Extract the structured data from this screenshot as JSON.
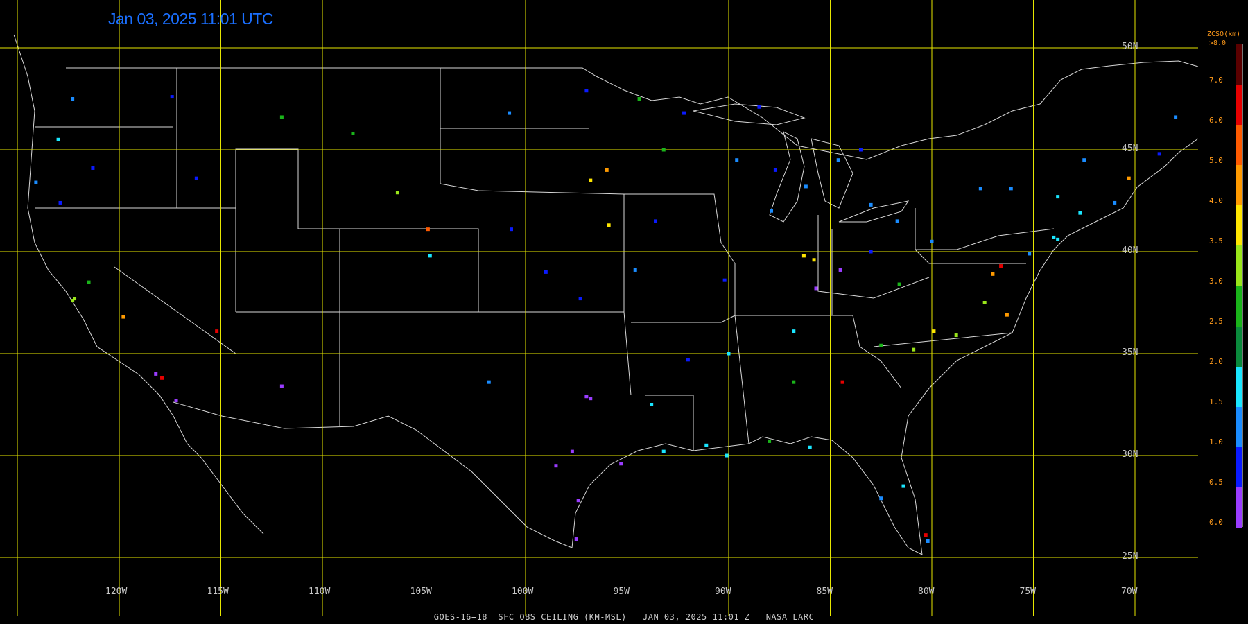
{
  "timestamp": "Jan 03, 2025 11:01 UTC",
  "footer": "GOES-16+18  SFC OBS CEILING (KM-MSL)   JAN 03, 2025 11:01 Z   NASA LARC",
  "colorbar": {
    "title": "ZCSO(km)",
    "max_label": ">8.0",
    "ticks": [
      "7.0",
      "6.0",
      "5.0",
      "4.0",
      "3.5",
      "3.0",
      "2.5",
      "2.0",
      "1.5",
      "1.0",
      "0.5",
      "0.0"
    ],
    "colors": [
      "#5a0000",
      "#e60000",
      "#ff5a00",
      "#ff9a00",
      "#ffe600",
      "#9ae61a",
      "#1ab41a",
      "#0a8a3c",
      "#1ae6ff",
      "#1a8cff",
      "#0a1aff",
      "#9a3cff"
    ]
  },
  "grid": {
    "lat_labels": [
      "50N",
      "45N",
      "40N",
      "35N",
      "30N",
      "25N"
    ],
    "lon_labels": [
      "120W",
      "115W",
      "110W",
      "105W",
      "100W",
      "95W",
      "90W",
      "85W",
      "80W",
      "75W",
      "70W"
    ],
    "lat_values": [
      50,
      45,
      40,
      35,
      30,
      25
    ],
    "lon_values": [
      -120,
      -115,
      -110,
      -105,
      -100,
      -95,
      -90,
      -85,
      -80,
      -75,
      -70
    ],
    "line_color": "#e6e600",
    "border_color": "#d8d8d8"
  },
  "stations": [
    {
      "lon": -122.3,
      "lat": 47.5,
      "c": "#1a8cff"
    },
    {
      "lon": -123.0,
      "lat": 45.5,
      "c": "#1ae6ff"
    },
    {
      "lon": -124.1,
      "lat": 43.4,
      "c": "#1a8cff"
    },
    {
      "lon": -121.3,
      "lat": 44.1,
      "c": "#0a1aff"
    },
    {
      "lon": -117.4,
      "lat": 47.6,
      "c": "#0a1aff"
    },
    {
      "lon": -116.2,
      "lat": 43.6,
      "c": "#0a1aff"
    },
    {
      "lon": -112.0,
      "lat": 46.6,
      "c": "#1ab41a"
    },
    {
      "lon": -108.5,
      "lat": 45.8,
      "c": "#1ab41a"
    },
    {
      "lon": -106.3,
      "lat": 42.9,
      "c": "#9ae61a"
    },
    {
      "lon": -104.8,
      "lat": 41.1,
      "c": "#ff5a00"
    },
    {
      "lon": -100.8,
      "lat": 46.8,
      "c": "#1a8cff"
    },
    {
      "lon": -96.8,
      "lat": 43.5,
      "c": "#ffe600"
    },
    {
      "lon": -95.9,
      "lat": 41.3,
      "c": "#ffe600"
    },
    {
      "lon": -96.0,
      "lat": 44.0,
      "c": "#ff9a00"
    },
    {
      "lon": -93.6,
      "lat": 41.5,
      "c": "#0a1aff"
    },
    {
      "lon": -93.2,
      "lat": 45.0,
      "c": "#1ab41a"
    },
    {
      "lon": -97.3,
      "lat": 37.7,
      "c": "#0a1aff"
    },
    {
      "lon": -94.6,
      "lat": 39.1,
      "c": "#1a8cff"
    },
    {
      "lon": -90.2,
      "lat": 38.6,
      "c": "#0a1aff"
    },
    {
      "lon": -87.9,
      "lat": 42.0,
      "c": "#1a8cff"
    },
    {
      "lon": -86.3,
      "lat": 39.8,
      "c": "#ffe600"
    },
    {
      "lon": -85.8,
      "lat": 39.6,
      "c": "#ffe600"
    },
    {
      "lon": -84.5,
      "lat": 39.1,
      "c": "#9a3cff"
    },
    {
      "lon": -83.0,
      "lat": 40.0,
      "c": "#0a1aff"
    },
    {
      "lon": -83.0,
      "lat": 42.3,
      "c": "#1a8cff"
    },
    {
      "lon": -81.7,
      "lat": 41.5,
      "c": "#1a8cff"
    },
    {
      "lon": -80.0,
      "lat": 40.5,
      "c": "#1a8cff"
    },
    {
      "lon": -77.0,
      "lat": 38.9,
      "c": "#ff9a00"
    },
    {
      "lon": -76.6,
      "lat": 39.3,
      "c": "#e60000"
    },
    {
      "lon": -75.2,
      "lat": 39.9,
      "c": "#1a8cff"
    },
    {
      "lon": -74.0,
      "lat": 40.7,
      "c": "#1ae6ff"
    },
    {
      "lon": -73.8,
      "lat": 40.6,
      "c": "#1ae6ff"
    },
    {
      "lon": -71.0,
      "lat": 42.4,
      "c": "#1a8cff"
    },
    {
      "lon": -70.3,
      "lat": 43.6,
      "c": "#ff9a00"
    },
    {
      "lon": -72.7,
      "lat": 41.9,
      "c": "#1ae6ff"
    },
    {
      "lon": -80.9,
      "lat": 35.2,
      "c": "#9ae61a"
    },
    {
      "lon": -78.8,
      "lat": 35.9,
      "c": "#9ae61a"
    },
    {
      "lon": -79.9,
      "lat": 36.1,
      "c": "#ffe600"
    },
    {
      "lon": -77.4,
      "lat": 37.5,
      "c": "#9ae61a"
    },
    {
      "lon": -76.3,
      "lat": 36.9,
      "c": "#ff9a00"
    },
    {
      "lon": -84.4,
      "lat": 33.6,
      "c": "#e60000"
    },
    {
      "lon": -86.8,
      "lat": 33.6,
      "c": "#1ab41a"
    },
    {
      "lon": -86.8,
      "lat": 36.1,
      "c": "#1ae6ff"
    },
    {
      "lon": -90.0,
      "lat": 35.0,
      "c": "#1ae6ff"
    },
    {
      "lon": -85.7,
      "lat": 38.2,
      "c": "#9a3cff"
    },
    {
      "lon": -82.5,
      "lat": 35.4,
      "c": "#1ab41a"
    },
    {
      "lon": -81.6,
      "lat": 38.4,
      "c": "#1ab41a"
    },
    {
      "lon": -90.1,
      "lat": 30.0,
      "c": "#1ae6ff"
    },
    {
      "lon": -91.1,
      "lat": 30.5,
      "c": "#1ae6ff"
    },
    {
      "lon": -93.2,
      "lat": 30.2,
      "c": "#1ae6ff"
    },
    {
      "lon": -95.3,
      "lat": 29.6,
      "c": "#9a3cff"
    },
    {
      "lon": -97.7,
      "lat": 30.2,
      "c": "#9a3cff"
    },
    {
      "lon": -98.5,
      "lat": 29.5,
      "c": "#9a3cff"
    },
    {
      "lon": -97.0,
      "lat": 32.9,
      "c": "#9a3cff"
    },
    {
      "lon": -96.8,
      "lat": 32.8,
      "c": "#9a3cff"
    },
    {
      "lon": -97.4,
      "lat": 27.8,
      "c": "#9a3cff"
    },
    {
      "lon": -97.5,
      "lat": 25.9,
      "c": "#9a3cff"
    },
    {
      "lon": -101.8,
      "lat": 33.6,
      "c": "#1a8cff"
    },
    {
      "lon": -93.8,
      "lat": 32.5,
      "c": "#1ae6ff"
    },
    {
      "lon": -92.0,
      "lat": 34.7,
      "c": "#0a1aff"
    },
    {
      "lon": -88.0,
      "lat": 30.7,
      "c": "#1ab41a"
    },
    {
      "lon": -86.0,
      "lat": 30.4,
      "c": "#1ae6ff"
    },
    {
      "lon": -81.4,
      "lat": 28.5,
      "c": "#1ae6ff"
    },
    {
      "lon": -80.2,
      "lat": 25.8,
      "c": "#1a8cff"
    },
    {
      "lon": -80.3,
      "lat": 26.1,
      "c": "#e60000"
    },
    {
      "lon": -82.5,
      "lat": 27.9,
      "c": "#1a8cff"
    },
    {
      "lon": -118.2,
      "lat": 34.0,
      "c": "#9a3cff"
    },
    {
      "lon": -117.9,
      "lat": 33.8,
      "c": "#e60000"
    },
    {
      "lon": -117.2,
      "lat": 32.7,
      "c": "#9a3cff"
    },
    {
      "lon": -119.8,
      "lat": 36.8,
      "c": "#ff9a00"
    },
    {
      "lon": -121.5,
      "lat": 38.5,
      "c": "#1ab41a"
    },
    {
      "lon": -122.3,
      "lat": 37.6,
      "c": "#9ae61a"
    },
    {
      "lon": -122.2,
      "lat": 37.7,
      "c": "#9ae61a"
    },
    {
      "lon": -122.9,
      "lat": 42.4,
      "c": "#0a1aff"
    },
    {
      "lon": -115.2,
      "lat": 36.1,
      "c": "#e60000"
    },
    {
      "lon": -112.0,
      "lat": 33.4,
      "c": "#9a3cff"
    },
    {
      "lon": -104.7,
      "lat": 39.8,
      "c": "#1ae6ff"
    },
    {
      "lon": -100.7,
      "lat": 41.1,
      "c": "#0a1aff"
    },
    {
      "lon": -99.0,
      "lat": 39.0,
      "c": "#0a1aff"
    },
    {
      "lon": -89.6,
      "lat": 44.5,
      "c": "#1a8cff"
    },
    {
      "lon": -87.7,
      "lat": 44.0,
      "c": "#0a1aff"
    },
    {
      "lon": -86.2,
      "lat": 43.2,
      "c": "#1a8cff"
    },
    {
      "lon": -84.6,
      "lat": 44.5,
      "c": "#1a8cff"
    },
    {
      "lon": -83.5,
      "lat": 45.0,
      "c": "#0a1aff"
    },
    {
      "lon": -88.5,
      "lat": 47.1,
      "c": "#0a1aff"
    },
    {
      "lon": -92.2,
      "lat": 46.8,
      "c": "#0a1aff"
    },
    {
      "lon": -94.4,
      "lat": 47.5,
      "c": "#1ab41a"
    },
    {
      "lon": -97.0,
      "lat": 47.9,
      "c": "#0a1aff"
    },
    {
      "lon": -77.6,
      "lat": 43.1,
      "c": "#1a8cff"
    },
    {
      "lon": -76.1,
      "lat": 43.1,
      "c": "#1a8cff"
    },
    {
      "lon": -73.8,
      "lat": 42.7,
      "c": "#1ae6ff"
    },
    {
      "lon": -72.5,
      "lat": 44.5,
      "c": "#1a8cff"
    },
    {
      "lon": -68.8,
      "lat": 44.8,
      "c": "#0a1aff"
    },
    {
      "lon": -68.0,
      "lat": 46.6,
      "c": "#1a8cff"
    }
  ]
}
